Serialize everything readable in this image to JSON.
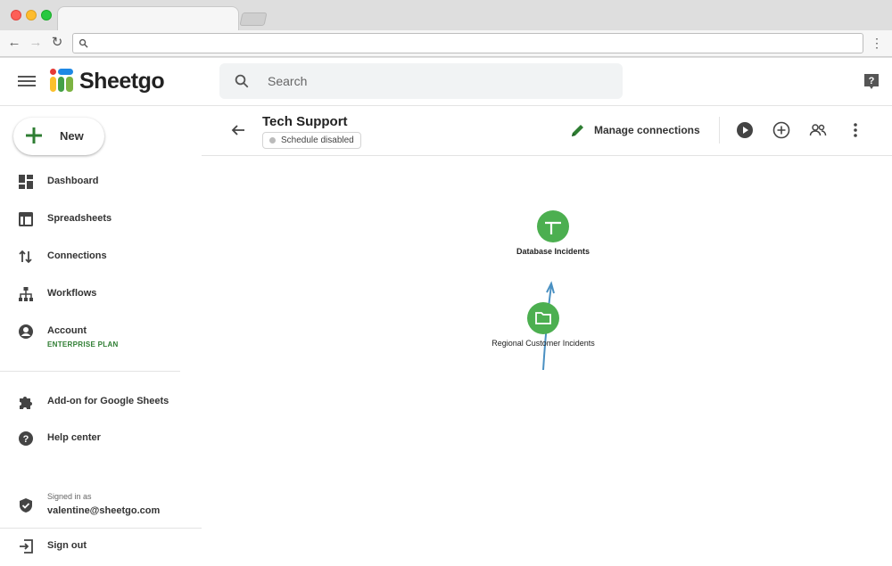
{
  "app": {
    "brand": "Sheetgo",
    "search_placeholder": "Search"
  },
  "sidebar": {
    "new_label": "New",
    "items": [
      {
        "label": "Dashboard",
        "icon": "dashboard-icon"
      },
      {
        "label": "Spreadsheets",
        "icon": "spreadsheet-icon"
      },
      {
        "label": "Connections",
        "icon": "connections-icon"
      },
      {
        "label": "Workflows",
        "icon": "workflows-icon"
      },
      {
        "label": "Account",
        "sublabel": "ENTERPRISE PLAN",
        "icon": "account-icon"
      }
    ],
    "secondary": [
      {
        "label": "Add-on for Google Sheets",
        "icon": "puzzle-icon"
      },
      {
        "label": "Help center",
        "icon": "help-circle-icon"
      }
    ],
    "signed_in_caption": "Signed in as",
    "signed_in_email": "valentine@sheetgo.com",
    "sign_out_label": "Sign out"
  },
  "workflow": {
    "title": "Tech Support",
    "schedule_status": "Schedule disabled",
    "manage_label": "Manage connections"
  },
  "canvas": {
    "nodes": [
      {
        "label": "Database Incidents",
        "icon": "spreadsheet-icon"
      },
      {
        "label": "Regional Customer Incidents",
        "icon": "folder-icon"
      }
    ]
  },
  "colors": {
    "accent_green": "#4caf50",
    "link_blue": "#4a90c2"
  }
}
